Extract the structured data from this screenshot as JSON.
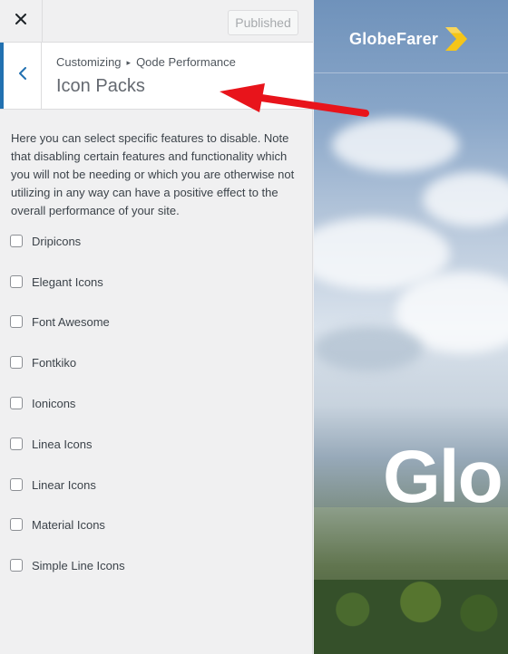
{
  "topbar": {
    "close_icon": "close-icon",
    "publish_label": "Published"
  },
  "section": {
    "breadcrumb": {
      "parent": "Customizing",
      "separator": "▸",
      "current": "Qode Performance"
    },
    "title": "Icon Packs",
    "back_icon": "chevron-left-icon"
  },
  "description": "Here you can select specific features to disable. Note that disabling certain features and functionality which you will not be needing or which you are otherwise not utilizing in any way can have a positive effect to the overall performance of your site.",
  "options": [
    {
      "label": "Dripicons",
      "checked": false
    },
    {
      "label": "Elegant Icons",
      "checked": false
    },
    {
      "label": "Font Awesome",
      "checked": false
    },
    {
      "label": "Fontkiko",
      "checked": false
    },
    {
      "label": "Ionicons",
      "checked": false
    },
    {
      "label": "Linea Icons",
      "checked": false
    },
    {
      "label": "Linear Icons",
      "checked": false
    },
    {
      "label": "Material Icons",
      "checked": false
    },
    {
      "label": "Simple Line Icons",
      "checked": false
    }
  ],
  "preview": {
    "logo_text": "GlobeFarer",
    "logo_icon": "chevron-logo-icon",
    "hero_text": "Glo"
  },
  "colors": {
    "accent": "#2271b1",
    "annotation_arrow": "#e8141b",
    "logo_mark": "#f5c518"
  }
}
